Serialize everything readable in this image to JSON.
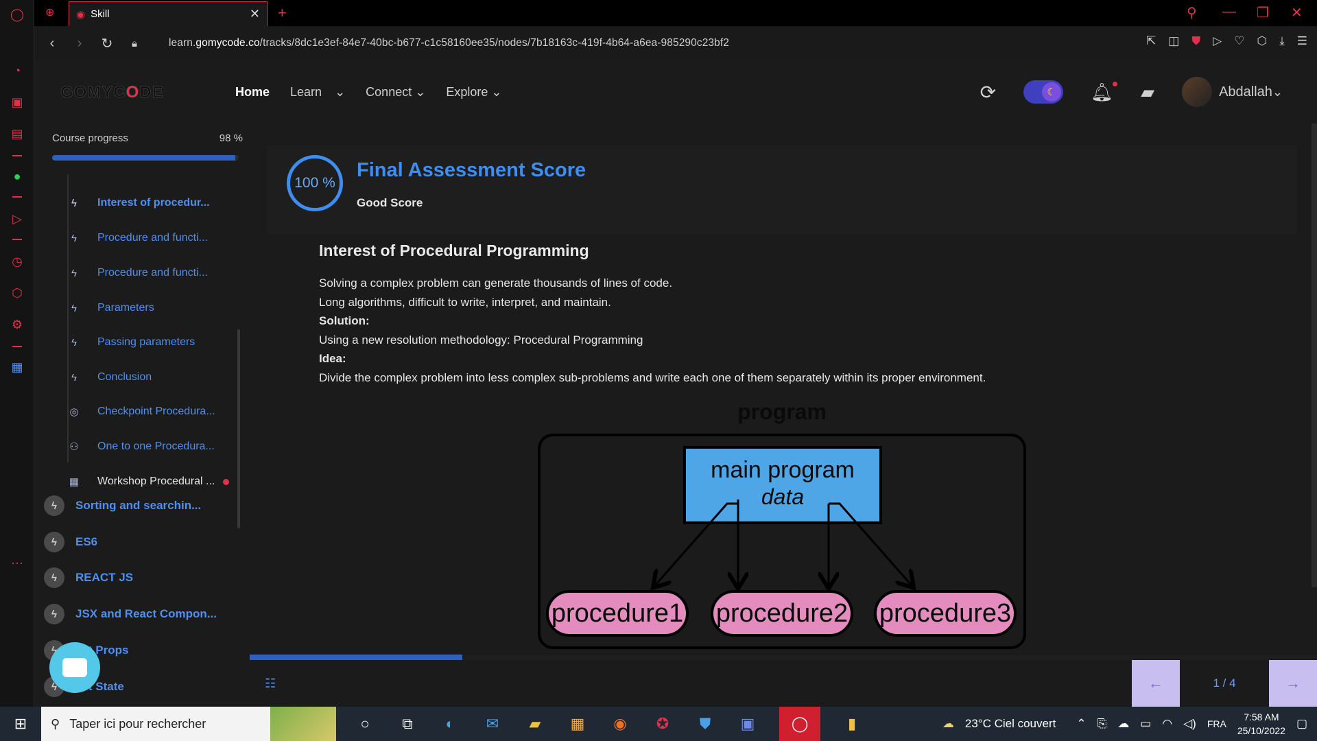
{
  "browser": {
    "tab_title": "Skill",
    "url_prefix": "learn.",
    "url_domain": "gomycode.co",
    "url_path": "/tracks/8dc1e3ef-84e7-40bc-b677-c1c58160ee35/nodes/7b18163c-419f-4b64-a6ea-985290c23bf2"
  },
  "header": {
    "logo_a": "GOMYC",
    "logo_b": "O",
    "logo_c": "DE",
    "nav": [
      "Home",
      "Learn",
      "Connect",
      "Explore"
    ],
    "username": "Abdallah"
  },
  "sidebar": {
    "progress_label": "Course progress",
    "progress_pct": "98 %",
    "progress_value": 0.98,
    "lessons": [
      {
        "label": "Interest of procedur...",
        "icon": "bolt-icon"
      },
      {
        "label": "Procedure and functi...",
        "icon": "bolt-icon"
      },
      {
        "label": "Procedure and functi...",
        "icon": "bolt-icon"
      },
      {
        "label": "Parameters",
        "icon": "bolt-icon"
      },
      {
        "label": "Passing parameters",
        "icon": "bolt-icon"
      },
      {
        "label": "Conclusion",
        "icon": "bolt-icon"
      },
      {
        "label": "Checkpoint Procedura...",
        "icon": "target-icon"
      },
      {
        "label": "One to one Procedura...",
        "icon": "people-icon"
      },
      {
        "label": "Workshop Procedural ...",
        "icon": "board-icon"
      }
    ],
    "modules": [
      "Sorting and searchin...",
      "ES6",
      "REACT JS",
      "JSX and React Compon...",
      "act Props",
      "act State"
    ]
  },
  "score": {
    "value": "100 %",
    "title": "Final Assessment Score",
    "subtitle": "Good Score"
  },
  "lesson": {
    "title": "Interest of Procedural Programming",
    "line1": "Solving a complex problem can generate thousands of lines of code.",
    "line2": "Long algorithms, difficult to write, interpret, and maintain.",
    "solution_label": "Solution:",
    "solution_text": "Using a new resolution methodology: Procedural Programming",
    "idea_label": "Idea:",
    "idea_text": "Divide the complex problem into less complex sub-problems and write each one of them separately within its proper environment."
  },
  "diagram": {
    "program_label": "program",
    "main_line1": "main program",
    "main_line2": "data",
    "procedures": [
      "procedure1",
      "procedure2",
      "procedure3"
    ]
  },
  "pager": {
    "count": "1 / 4",
    "prev": "←",
    "next": "→"
  },
  "taskbar": {
    "search_placeholder": "Taper ici pour rechercher",
    "weather": "23°C  Ciel couvert",
    "lang": "FRA",
    "time": "7:58 AM",
    "date": "25/10/2022"
  },
  "colors": {
    "accent_blue": "#3d8ef0",
    "opera_red": "#e0304a",
    "diagram_box": "#4ea6e6",
    "diagram_proc": "#e58cbf"
  }
}
